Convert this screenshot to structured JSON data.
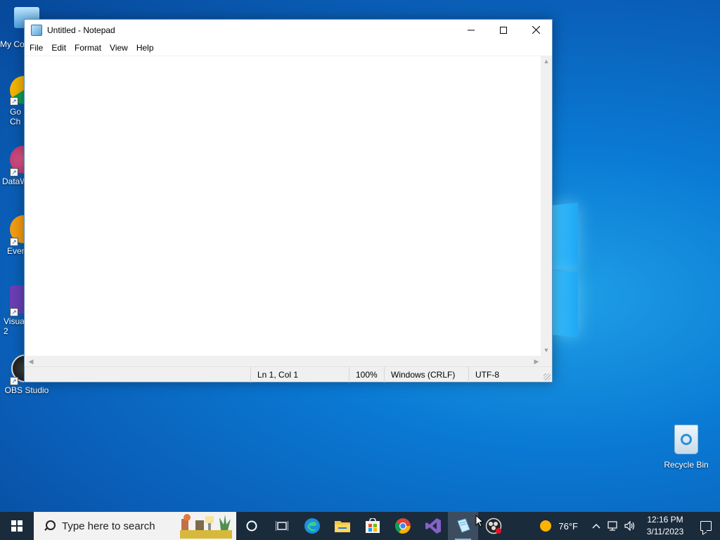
{
  "desktop": {
    "icons": [
      {
        "label": "My Co"
      },
      {
        "label": "Go\nCh"
      },
      {
        "label": "DataW"
      },
      {
        "label": "Ever"
      },
      {
        "label": "Visua\n2"
      },
      {
        "label": "OBS Studio"
      }
    ],
    "recycle_bin": {
      "label": "Recycle Bin"
    }
  },
  "window": {
    "title": "Untitled - Notepad",
    "controls": {
      "minimize": "—",
      "maximize": "☐",
      "close": "✕"
    },
    "menu": [
      "File",
      "Edit",
      "Format",
      "View",
      "Help"
    ],
    "editor_text": "",
    "status": {
      "position": "Ln 1, Col 1",
      "zoom": "100%",
      "line_ending": "Windows (CRLF)",
      "encoding": "UTF-8"
    }
  },
  "taskbar": {
    "search_placeholder": "Type here to search",
    "apps": [
      {
        "icon": "cortana-icon"
      },
      {
        "icon": "task-view-icon"
      },
      {
        "icon": "edge-icon"
      },
      {
        "icon": "file-explorer-icon"
      },
      {
        "icon": "microsoft-store-icon"
      },
      {
        "icon": "chrome-icon"
      },
      {
        "icon": "visual-studio-icon"
      },
      {
        "icon": "notepad-icon"
      },
      {
        "icon": "obs-studio-icon"
      }
    ],
    "weather": {
      "temp": "76°F"
    },
    "clock": {
      "time": "12:16 PM",
      "date": "3/11/2023"
    }
  }
}
